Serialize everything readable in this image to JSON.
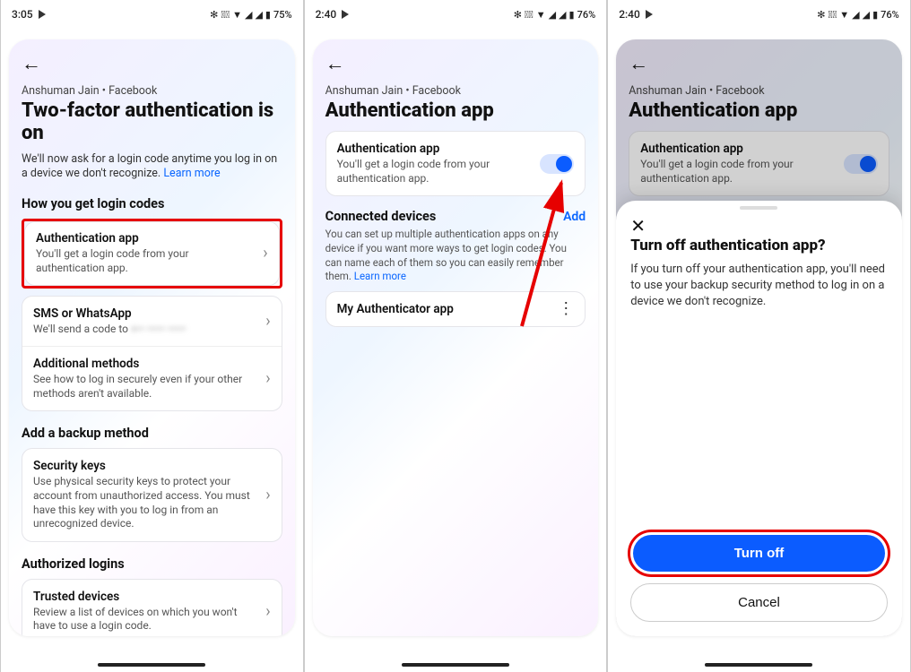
{
  "screen1": {
    "status": {
      "time": "3:05",
      "battery": "75%"
    },
    "crumb": "Anshuman Jain • Facebook",
    "title": "Two-factor authentication is on",
    "body": "We'll now ask for a login code anytime you log in on a device we don't recognize. ",
    "learn_more": "Learn more",
    "section_codes": "How you get login codes",
    "auth_app": {
      "title": "Authentication app",
      "sub": "You'll get a login code from your authentication app."
    },
    "sms": {
      "title": "SMS or WhatsApp",
      "sub": "We'll send a code to "
    },
    "additional": {
      "title": "Additional methods",
      "sub": "See how to log in securely even if your other methods aren't available."
    },
    "section_backup": "Add a backup method",
    "security_keys": {
      "title": "Security keys",
      "sub": "Use physical security keys to protect your account from unauthorized access. You must have this key with you to log in from an unrecognized device."
    },
    "section_auth": "Authorized logins",
    "trusted": {
      "title": "Trusted devices",
      "sub": "Review a list of devices on which you won't have to use a login code."
    }
  },
  "screen2": {
    "status": {
      "time": "2:40",
      "battery": "76%"
    },
    "crumb": "Anshuman Jain • Facebook",
    "title": "Authentication app",
    "card_title": "Authentication app",
    "card_sub": "You'll get a login code from your authentication app.",
    "connected": "Connected devices",
    "add": "Add",
    "conn_desc": "You can set up multiple authentication apps on any device if you want more ways to get login codes. You can name each of them so you can easily remember them. ",
    "learn_more": "Learn more",
    "device1": "My Authenticator app"
  },
  "screen3": {
    "status": {
      "time": "2:40",
      "battery": "76%"
    },
    "crumb": "Anshuman Jain • Facebook",
    "title": "Authentication app",
    "card_title": "Authentication app",
    "card_sub": "You'll get a login code from your authentication app.",
    "sheet_title": "Turn off authentication app?",
    "sheet_body": "If you turn off your authentication app, you'll need to use your backup security method to log in on a device we don't recognize.",
    "turn_off": "Turn off",
    "cancel": "Cancel"
  },
  "icons": {
    "bt": "✻",
    "vibrate": "◻",
    "wifi": "▾",
    "sig1": "◢",
    "sig2": "◢",
    "bat": "▮"
  }
}
